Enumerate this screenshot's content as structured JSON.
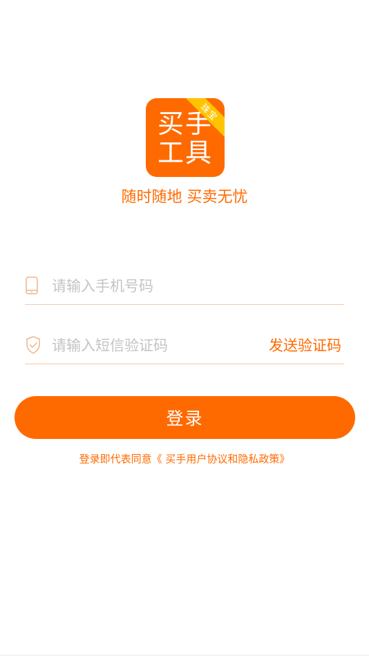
{
  "logo": {
    "line1": "买手",
    "line2": "工具",
    "ribbon": "珠宝",
    "colors": {
      "background": "#ff6a00",
      "ribbon": "#ffc400"
    }
  },
  "slogan": "随时随地 买卖无忧",
  "form": {
    "phone": {
      "placeholder": "请输入手机号码",
      "value": "",
      "icon": "phone-icon"
    },
    "code": {
      "placeholder": "请输入短信验证码",
      "value": "",
      "icon": "shield-check-icon",
      "send_label": "发送验证码"
    }
  },
  "login_button": "登录",
  "agreement": {
    "prefix": "登录即代表同意",
    "link": "《 买手用户协议和隐私政策》"
  },
  "theme": {
    "accent": "#ff6a00",
    "divider": "#f5c7a7",
    "placeholder": "#c4c4c4"
  }
}
